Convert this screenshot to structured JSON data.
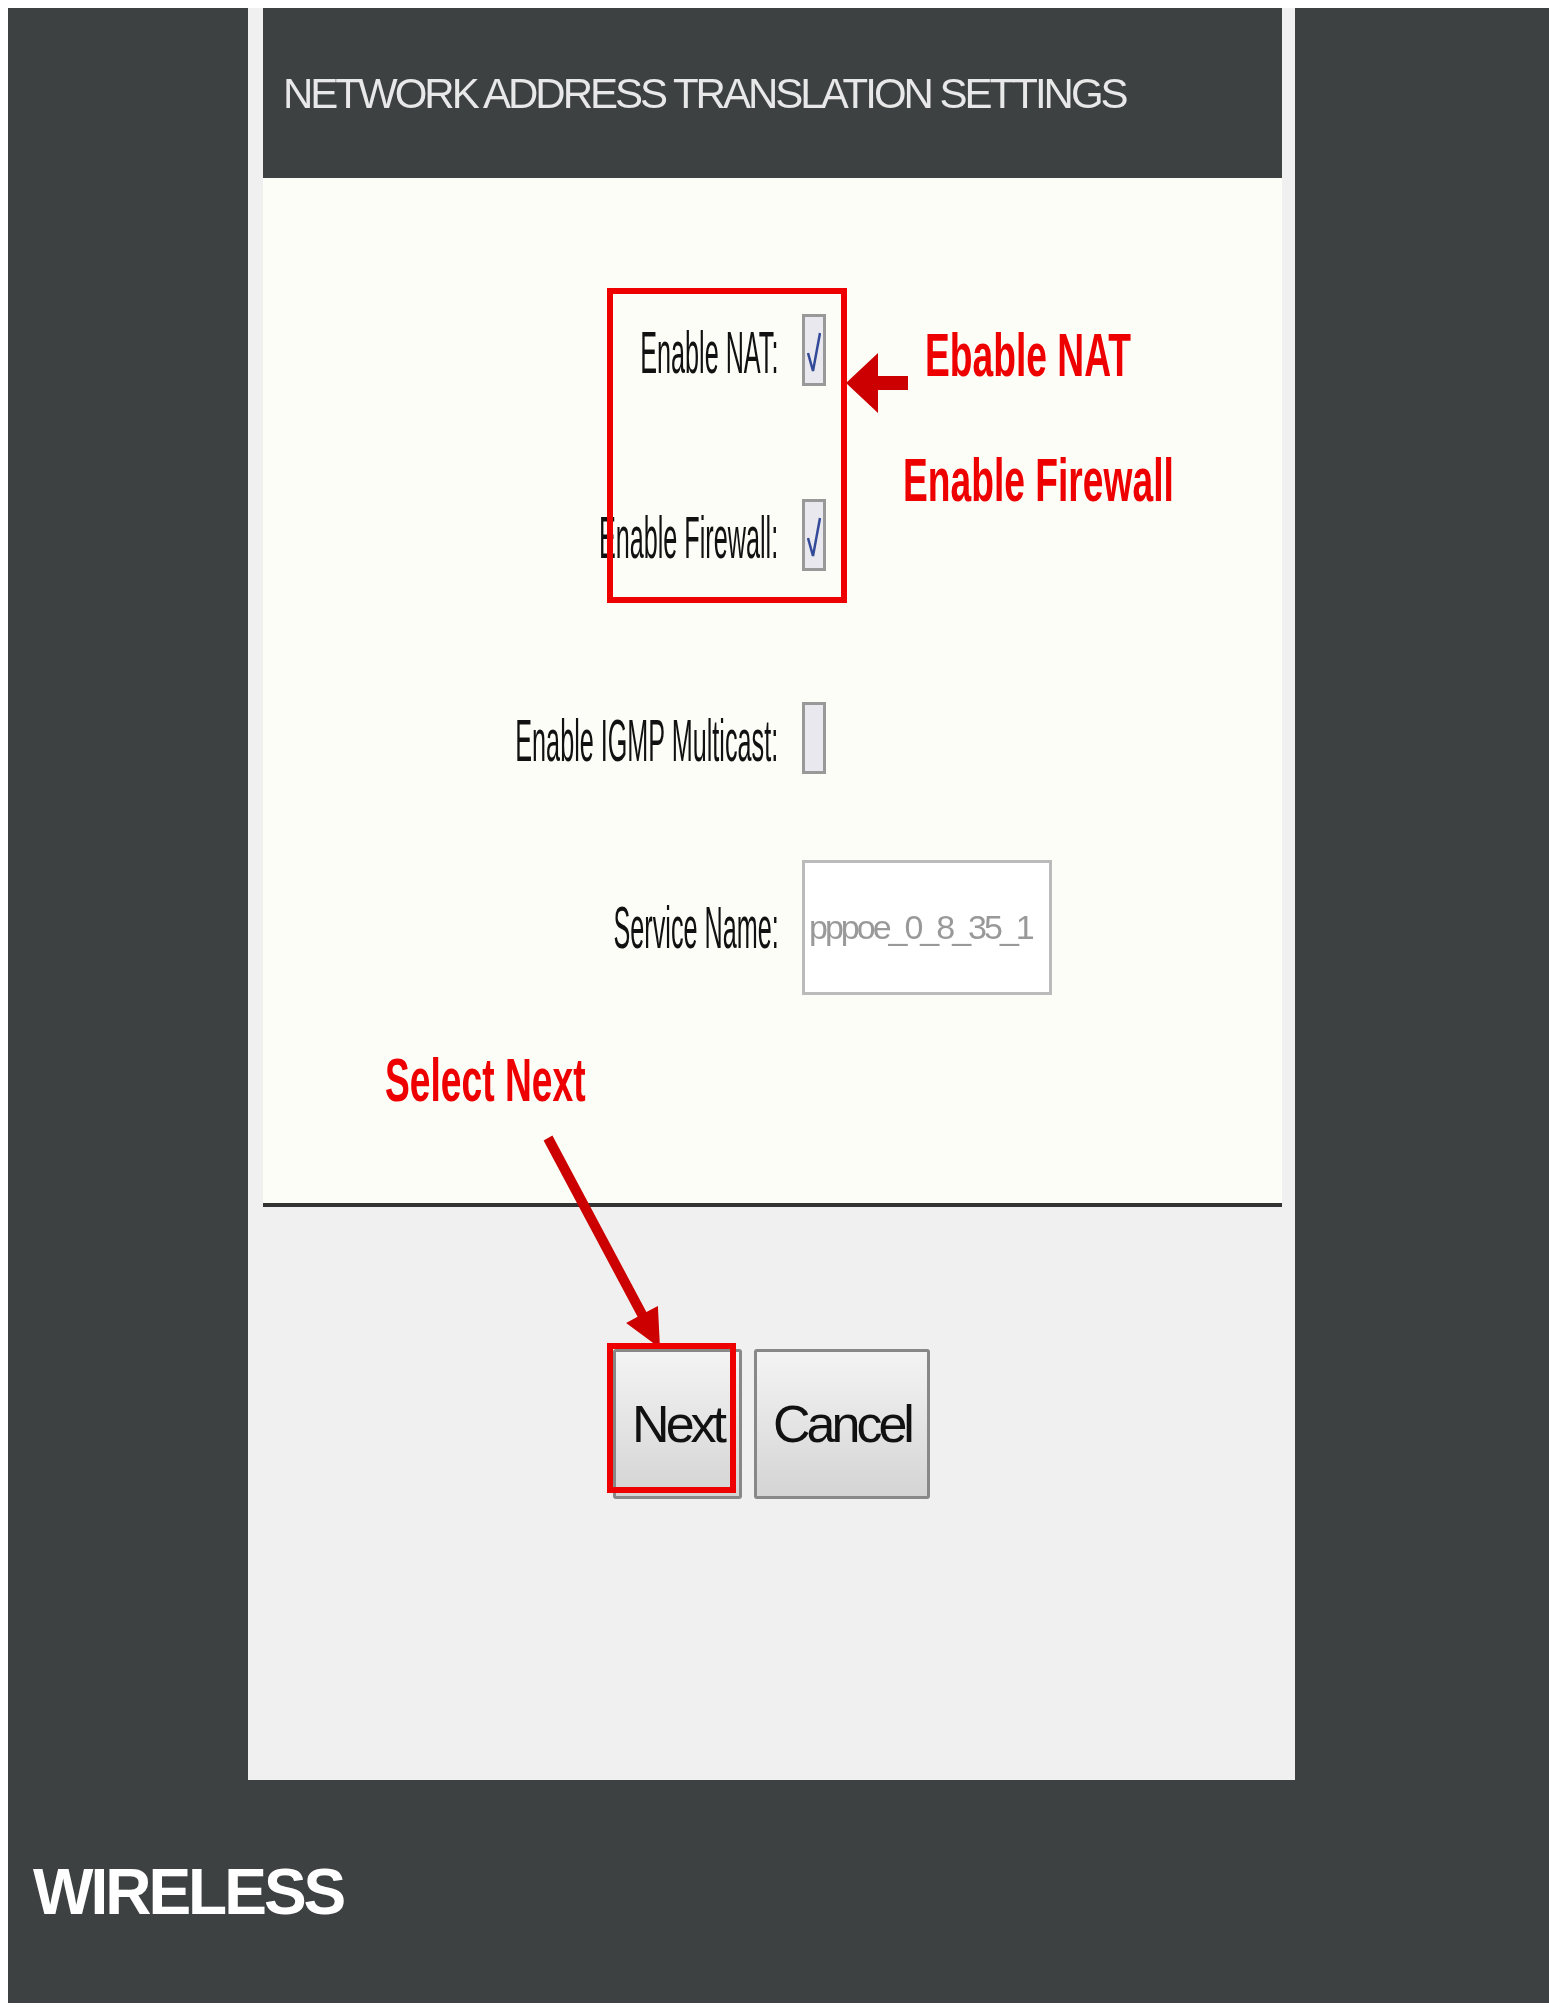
{
  "header": {
    "title": "NETWORK ADDRESS TRANSLATION SETTINGS"
  },
  "fields": [
    {
      "kind": "checkbox",
      "label": "Enable NAT:",
      "checked": true
    },
    {
      "kind": "checkbox",
      "label": "Enable Firewall:",
      "checked": true
    },
    {
      "kind": "checkbox",
      "label": "Enable IGMP Multicast:",
      "checked": false
    },
    {
      "kind": "text",
      "label": "Service Name:",
      "value": "pppoe_0_8_35_1",
      "disabled": true
    }
  ],
  "buttons": [
    {
      "label": "Next"
    },
    {
      "label": "Cancel"
    }
  ],
  "annotations": [
    {
      "text": "Ebable NAT"
    },
    {
      "text": "Enable Firewall"
    },
    {
      "text": "Select Next"
    }
  ],
  "footer": {
    "title": "WIRELESS"
  }
}
